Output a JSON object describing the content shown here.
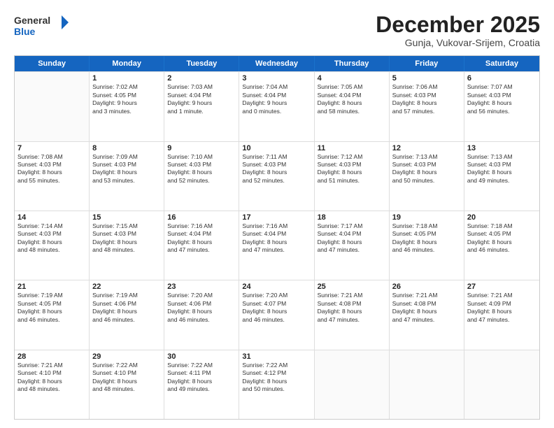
{
  "header": {
    "logo_line1": "General",
    "logo_line2": "Blue",
    "month": "December 2025",
    "location": "Gunja, Vukovar-Srijem, Croatia"
  },
  "weekdays": [
    "Sunday",
    "Monday",
    "Tuesday",
    "Wednesday",
    "Thursday",
    "Friday",
    "Saturday"
  ],
  "weeks": [
    [
      {
        "day": "",
        "info": ""
      },
      {
        "day": "1",
        "info": "Sunrise: 7:02 AM\nSunset: 4:05 PM\nDaylight: 9 hours\nand 3 minutes."
      },
      {
        "day": "2",
        "info": "Sunrise: 7:03 AM\nSunset: 4:04 PM\nDaylight: 9 hours\nand 1 minute."
      },
      {
        "day": "3",
        "info": "Sunrise: 7:04 AM\nSunset: 4:04 PM\nDaylight: 9 hours\nand 0 minutes."
      },
      {
        "day": "4",
        "info": "Sunrise: 7:05 AM\nSunset: 4:04 PM\nDaylight: 8 hours\nand 58 minutes."
      },
      {
        "day": "5",
        "info": "Sunrise: 7:06 AM\nSunset: 4:03 PM\nDaylight: 8 hours\nand 57 minutes."
      },
      {
        "day": "6",
        "info": "Sunrise: 7:07 AM\nSunset: 4:03 PM\nDaylight: 8 hours\nand 56 minutes."
      }
    ],
    [
      {
        "day": "7",
        "info": "Sunrise: 7:08 AM\nSunset: 4:03 PM\nDaylight: 8 hours\nand 55 minutes."
      },
      {
        "day": "8",
        "info": "Sunrise: 7:09 AM\nSunset: 4:03 PM\nDaylight: 8 hours\nand 53 minutes."
      },
      {
        "day": "9",
        "info": "Sunrise: 7:10 AM\nSunset: 4:03 PM\nDaylight: 8 hours\nand 52 minutes."
      },
      {
        "day": "10",
        "info": "Sunrise: 7:11 AM\nSunset: 4:03 PM\nDaylight: 8 hours\nand 52 minutes."
      },
      {
        "day": "11",
        "info": "Sunrise: 7:12 AM\nSunset: 4:03 PM\nDaylight: 8 hours\nand 51 minutes."
      },
      {
        "day": "12",
        "info": "Sunrise: 7:13 AM\nSunset: 4:03 PM\nDaylight: 8 hours\nand 50 minutes."
      },
      {
        "day": "13",
        "info": "Sunrise: 7:13 AM\nSunset: 4:03 PM\nDaylight: 8 hours\nand 49 minutes."
      }
    ],
    [
      {
        "day": "14",
        "info": "Sunrise: 7:14 AM\nSunset: 4:03 PM\nDaylight: 8 hours\nand 48 minutes."
      },
      {
        "day": "15",
        "info": "Sunrise: 7:15 AM\nSunset: 4:03 PM\nDaylight: 8 hours\nand 48 minutes."
      },
      {
        "day": "16",
        "info": "Sunrise: 7:16 AM\nSunset: 4:04 PM\nDaylight: 8 hours\nand 47 minutes."
      },
      {
        "day": "17",
        "info": "Sunrise: 7:16 AM\nSunset: 4:04 PM\nDaylight: 8 hours\nand 47 minutes."
      },
      {
        "day": "18",
        "info": "Sunrise: 7:17 AM\nSunset: 4:04 PM\nDaylight: 8 hours\nand 47 minutes."
      },
      {
        "day": "19",
        "info": "Sunrise: 7:18 AM\nSunset: 4:05 PM\nDaylight: 8 hours\nand 46 minutes."
      },
      {
        "day": "20",
        "info": "Sunrise: 7:18 AM\nSunset: 4:05 PM\nDaylight: 8 hours\nand 46 minutes."
      }
    ],
    [
      {
        "day": "21",
        "info": "Sunrise: 7:19 AM\nSunset: 4:05 PM\nDaylight: 8 hours\nand 46 minutes."
      },
      {
        "day": "22",
        "info": "Sunrise: 7:19 AM\nSunset: 4:06 PM\nDaylight: 8 hours\nand 46 minutes."
      },
      {
        "day": "23",
        "info": "Sunrise: 7:20 AM\nSunset: 4:06 PM\nDaylight: 8 hours\nand 46 minutes."
      },
      {
        "day": "24",
        "info": "Sunrise: 7:20 AM\nSunset: 4:07 PM\nDaylight: 8 hours\nand 46 minutes."
      },
      {
        "day": "25",
        "info": "Sunrise: 7:21 AM\nSunset: 4:08 PM\nDaylight: 8 hours\nand 47 minutes."
      },
      {
        "day": "26",
        "info": "Sunrise: 7:21 AM\nSunset: 4:08 PM\nDaylight: 8 hours\nand 47 minutes."
      },
      {
        "day": "27",
        "info": "Sunrise: 7:21 AM\nSunset: 4:09 PM\nDaylight: 8 hours\nand 47 minutes."
      }
    ],
    [
      {
        "day": "28",
        "info": "Sunrise: 7:21 AM\nSunset: 4:10 PM\nDaylight: 8 hours\nand 48 minutes."
      },
      {
        "day": "29",
        "info": "Sunrise: 7:22 AM\nSunset: 4:10 PM\nDaylight: 8 hours\nand 48 minutes."
      },
      {
        "day": "30",
        "info": "Sunrise: 7:22 AM\nSunset: 4:11 PM\nDaylight: 8 hours\nand 49 minutes."
      },
      {
        "day": "31",
        "info": "Sunrise: 7:22 AM\nSunset: 4:12 PM\nDaylight: 8 hours\nand 50 minutes."
      },
      {
        "day": "",
        "info": ""
      },
      {
        "day": "",
        "info": ""
      },
      {
        "day": "",
        "info": ""
      }
    ]
  ]
}
